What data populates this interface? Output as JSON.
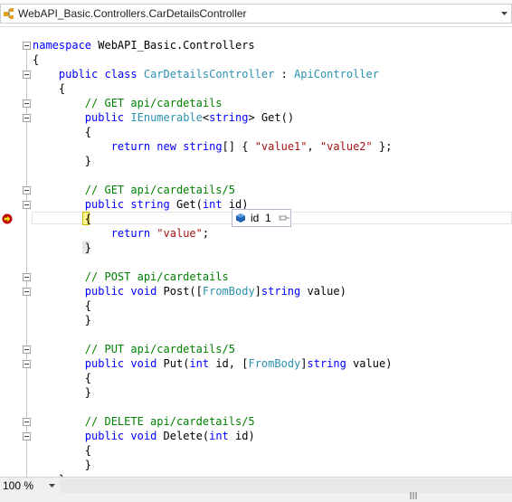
{
  "navigation": {
    "type_selector": "WebAPI_Basic.Controllers.CarDetailsController",
    "type_icon": "class-icon"
  },
  "code": [
    {
      "tokens": [
        {
          "t": "namespace",
          "c": "kw"
        },
        {
          "t": " WebAPI_Basic.Controllers"
        }
      ]
    },
    {
      "tokens": [
        {
          "t": "{"
        }
      ]
    },
    {
      "tokens": [
        {
          "t": "    "
        },
        {
          "t": "public",
          "c": "kw"
        },
        {
          "t": " "
        },
        {
          "t": "class",
          "c": "kw"
        },
        {
          "t": " "
        },
        {
          "t": "CarDetailsController",
          "c": "ty"
        },
        {
          "t": " : "
        },
        {
          "t": "ApiController",
          "c": "ty"
        }
      ]
    },
    {
      "tokens": [
        {
          "t": "    {"
        }
      ]
    },
    {
      "tokens": [
        {
          "t": "        "
        },
        {
          "t": "// GET api/cardetails",
          "c": "cm"
        }
      ]
    },
    {
      "tokens": [
        {
          "t": "        "
        },
        {
          "t": "public",
          "c": "kw"
        },
        {
          "t": " "
        },
        {
          "t": "IEnumerable",
          "c": "ty"
        },
        {
          "t": "<"
        },
        {
          "t": "string",
          "c": "kw"
        },
        {
          "t": "> Get()"
        }
      ]
    },
    {
      "tokens": [
        {
          "t": "        {"
        }
      ]
    },
    {
      "tokens": [
        {
          "t": "            "
        },
        {
          "t": "return",
          "c": "kw"
        },
        {
          "t": " "
        },
        {
          "t": "new",
          "c": "kw"
        },
        {
          "t": " "
        },
        {
          "t": "string",
          "c": "kw"
        },
        {
          "t": "[] { "
        },
        {
          "t": "\"value1\"",
          "c": "st"
        },
        {
          "t": ", "
        },
        {
          "t": "\"value2\"",
          "c": "st"
        },
        {
          "t": " };"
        }
      ]
    },
    {
      "tokens": [
        {
          "t": "        }"
        }
      ]
    },
    {
      "tokens": []
    },
    {
      "tokens": [
        {
          "t": "        "
        },
        {
          "t": "// GET api/cardetails/5",
          "c": "cm"
        }
      ]
    },
    {
      "tokens": [
        {
          "t": "        "
        },
        {
          "t": "public",
          "c": "kw"
        },
        {
          "t": " "
        },
        {
          "t": "string",
          "c": "kw"
        },
        {
          "t": " Get("
        },
        {
          "t": "int",
          "c": "kw"
        },
        {
          "t": " id)"
        }
      ]
    },
    {
      "tokens": [
        {
          "t": "        {"
        }
      ]
    },
    {
      "tokens": [
        {
          "t": "            "
        },
        {
          "t": "return",
          "c": "kw"
        },
        {
          "t": " "
        },
        {
          "t": "\"value\"",
          "c": "st"
        },
        {
          "t": ";"
        }
      ]
    },
    {
      "tokens": [
        {
          "t": "        }"
        }
      ]
    },
    {
      "tokens": []
    },
    {
      "tokens": [
        {
          "t": "        "
        },
        {
          "t": "// POST api/cardetails",
          "c": "cm"
        }
      ]
    },
    {
      "tokens": [
        {
          "t": "        "
        },
        {
          "t": "public",
          "c": "kw"
        },
        {
          "t": " "
        },
        {
          "t": "void",
          "c": "kw"
        },
        {
          "t": " Post(["
        },
        {
          "t": "FromBody",
          "c": "ty"
        },
        {
          "t": "]"
        },
        {
          "t": "string",
          "c": "kw"
        },
        {
          "t": " value)"
        }
      ]
    },
    {
      "tokens": [
        {
          "t": "        {"
        }
      ]
    },
    {
      "tokens": [
        {
          "t": "        }"
        }
      ]
    },
    {
      "tokens": []
    },
    {
      "tokens": [
        {
          "t": "        "
        },
        {
          "t": "// PUT api/cardetails/5",
          "c": "cm"
        }
      ]
    },
    {
      "tokens": [
        {
          "t": "        "
        },
        {
          "t": "public",
          "c": "kw"
        },
        {
          "t": " "
        },
        {
          "t": "void",
          "c": "kw"
        },
        {
          "t": " Put("
        },
        {
          "t": "int",
          "c": "kw"
        },
        {
          "t": " id, ["
        },
        {
          "t": "FromBody",
          "c": "ty"
        },
        {
          "t": "]"
        },
        {
          "t": "string",
          "c": "kw"
        },
        {
          "t": " value)"
        }
      ]
    },
    {
      "tokens": [
        {
          "t": "        {"
        }
      ]
    },
    {
      "tokens": [
        {
          "t": "        }"
        }
      ]
    },
    {
      "tokens": []
    },
    {
      "tokens": [
        {
          "t": "        "
        },
        {
          "t": "// DELETE api/cardetails/5",
          "c": "cm"
        }
      ]
    },
    {
      "tokens": [
        {
          "t": "        "
        },
        {
          "t": "public",
          "c": "kw"
        },
        {
          "t": " "
        },
        {
          "t": "void",
          "c": "kw"
        },
        {
          "t": " Delete("
        },
        {
          "t": "int",
          "c": "kw"
        },
        {
          "t": " id)"
        }
      ]
    },
    {
      "tokens": [
        {
          "t": "        {"
        }
      ]
    },
    {
      "tokens": [
        {
          "t": "        }"
        }
      ]
    },
    {
      "tokens": [
        {
          "t": "    }"
        }
      ]
    }
  ],
  "fold_lines": [
    0,
    2,
    4,
    5,
    10,
    11,
    16,
    17,
    21,
    22,
    26,
    27
  ],
  "breakpoint": {
    "icon": "breakpoint-current-statement-icon",
    "color": "#c80000",
    "arrow_color": "#ffd800"
  },
  "datatip": {
    "name": "id",
    "value": "1",
    "type_icon": "local-variable-icon",
    "pin_icon": "pin-icon"
  },
  "statusbar": {
    "zoom": "100 %"
  },
  "colors": {
    "keyword": "#0000ff",
    "type": "#2b91af",
    "comment": "#008000",
    "string": "#a31515"
  }
}
